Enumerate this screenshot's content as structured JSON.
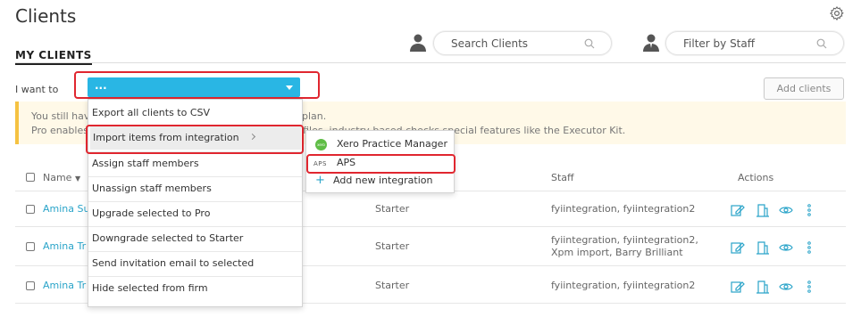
{
  "header": {
    "title": "Clients",
    "section_tab": "MY CLIENTS",
    "search_placeholder": "Search Clients",
    "staff_filter_placeholder": "Filter by Staff"
  },
  "action_bar": {
    "label": "I want to",
    "dropdown_value": "...",
    "add_clients": "Add clients"
  },
  "notice": {
    "line1_left": "You still hav",
    "line1_right": "plan.",
    "line2_left": "Pro enables",
    "line2_right": "rted files, industry-based checks special features like the Executor Kit."
  },
  "table": {
    "headers": {
      "name": "Name",
      "staff": "Staff",
      "actions": "Actions"
    },
    "rows": [
      {
        "name": "Amina Su",
        "plan": "Starter",
        "staff": [
          "fyiintegration, fyiintegration2"
        ]
      },
      {
        "name": "Amina Tr",
        "plan": "Starter",
        "staff": [
          "fyiintegration, fyiintegration2,",
          "Xpm import, Barry Brilliant"
        ]
      },
      {
        "name": "Amina Tr",
        "plan": "Starter",
        "staff": [
          "fyiintegration, fyiintegration2"
        ]
      }
    ]
  },
  "menu": {
    "items": [
      "Export all clients to CSV",
      "Import items from integration",
      "Assign staff members",
      "Unassign staff members",
      "Upgrade selected to Pro",
      "Downgrade selected to Starter",
      "Send invitation email to selected",
      "Hide selected from firm"
    ]
  },
  "submenu": {
    "xero_logo": "xero",
    "items": [
      "Xero Practice Manager",
      "APS",
      "Add new integration"
    ],
    "aps_logo": "APS"
  },
  "colors": {
    "accent": "#29b6e4",
    "highlight": "#e0262f",
    "link": "#2aa4c9",
    "notice_bar": "#f5c242"
  },
  "icons": [
    "gear-icon",
    "person-icon",
    "search-icon",
    "caret-down-icon",
    "sort-down-icon",
    "chevron-right-icon",
    "edit-icon",
    "building-icon",
    "eye-icon",
    "more-vertical-icon",
    "plus-icon"
  ]
}
